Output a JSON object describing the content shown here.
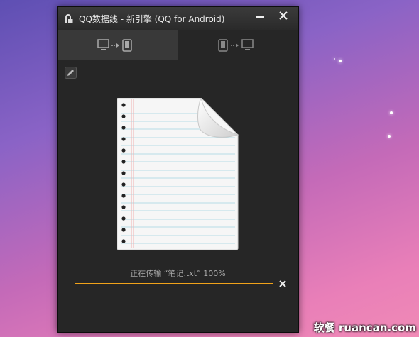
{
  "window": {
    "title": "QQ数据线 - 新引擎 (QQ for Android)"
  },
  "tabs": [
    {
      "icon": "pc-to-phone-icon",
      "active": true
    },
    {
      "icon": "phone-to-pc-icon",
      "active": false
    }
  ],
  "transfer": {
    "status_text": "正在传输 “笔记.txt” 100%",
    "progress": 1.0
  },
  "colors": {
    "accent": "#f0a21a",
    "window_bg": "#262626"
  },
  "watermark": "软餐 ruancan.com"
}
